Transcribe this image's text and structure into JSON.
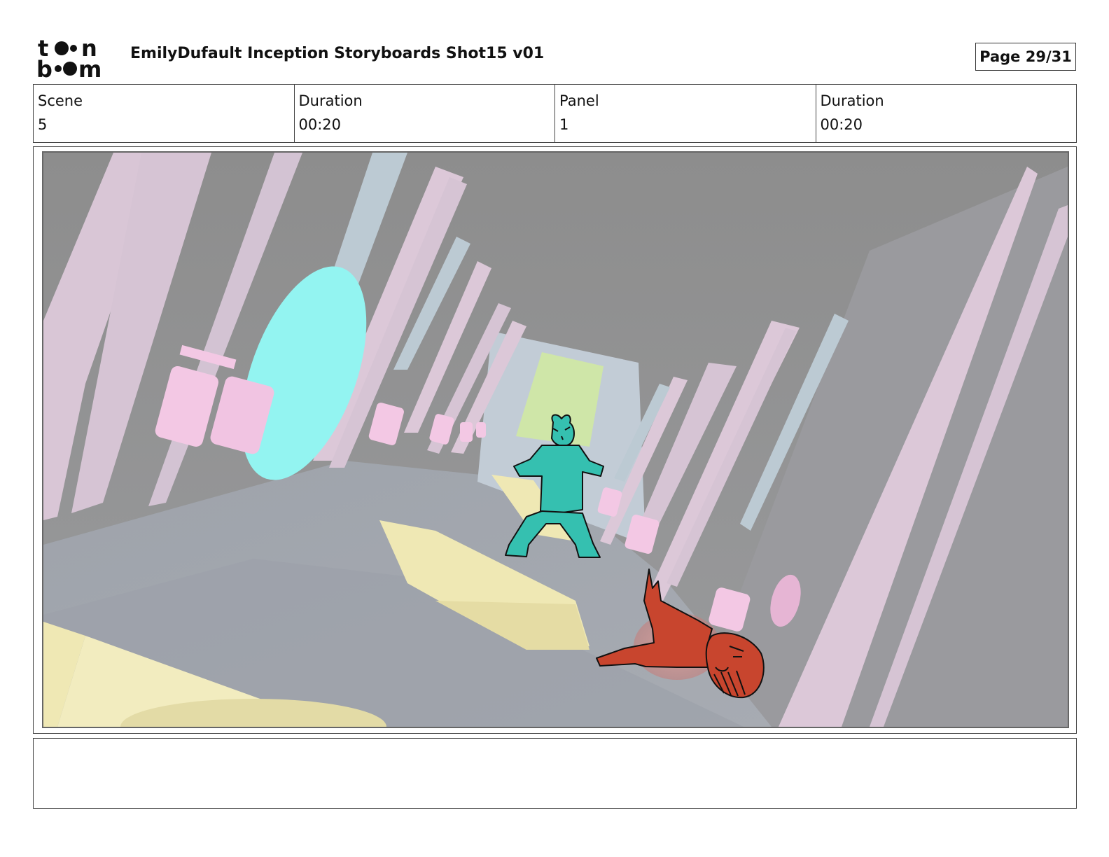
{
  "header": {
    "logo_text_top": "toon",
    "logo_text_bottom": "boom",
    "title": "EmilyDufault Inception Storyboards Shot15 v01",
    "page_label": "Page 29/31"
  },
  "info": {
    "scene_label": "Scene",
    "scene_value": "5",
    "scene_duration_label": "Duration",
    "scene_duration_value": "00:20",
    "panel_label": "Panel",
    "panel_value": "1",
    "panel_duration_label": "Duration",
    "panel_duration_value": "00:20"
  },
  "panel": {
    "illustration": "storyboard-frame",
    "characters": [
      "crouching-figure-teal",
      "fallen-figure-red"
    ]
  },
  "notes": {
    "text": ""
  },
  "colors": {
    "wall_pink": "#dcc8d8",
    "wall_blue": "#bccad3",
    "floor_gray": "#a3a7ae",
    "ceiling_gray": "#8f8f8f",
    "portal_cyan": "#93f4f1",
    "figure_teal": "#35c0b0",
    "figure_red": "#c8452e",
    "pink_prop": "#f3c8e4",
    "yellow_prop": "#efe8b4",
    "green_door": "#cfe6a8"
  }
}
